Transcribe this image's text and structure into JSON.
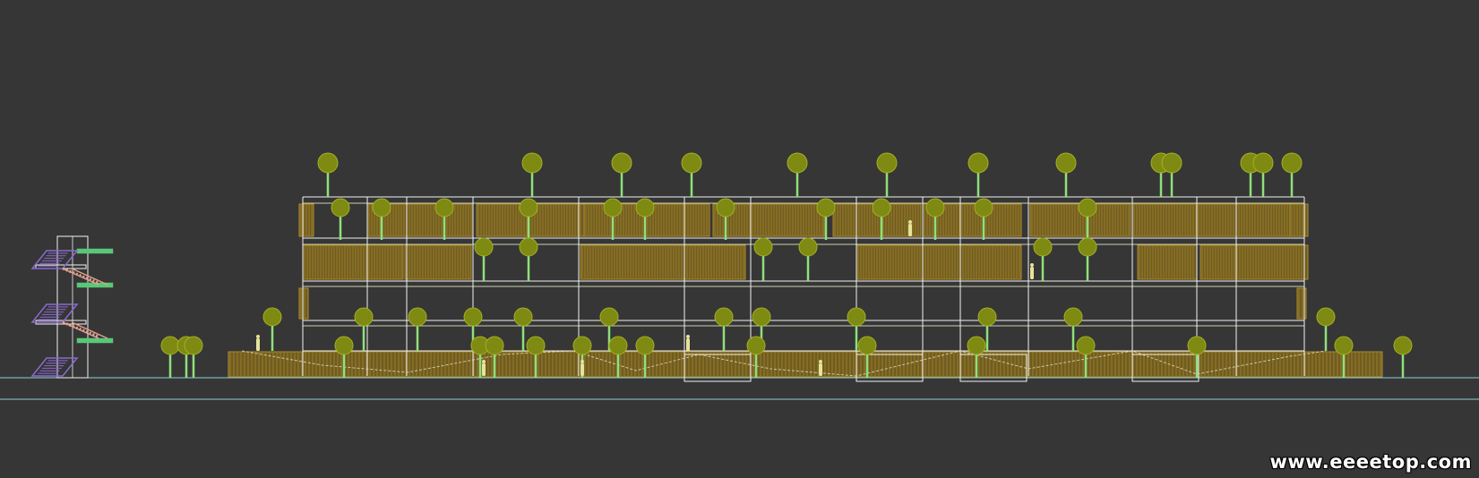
{
  "watermark": "www.eeeetop.com",
  "colors": {
    "background": "#363636",
    "ground_line": "#8fd0d8",
    "frame": "#f2f2f2",
    "floor_band": "#cbd0b0",
    "louver_fill": "#6f5c22",
    "louver_stroke": "#b08e2a",
    "louver_dark": "#4e4219",
    "tree_crown": "#7e8a12",
    "tree_crown_edge": "#a4b022",
    "tree_trunk": "#8fe07a",
    "person": "#e4e49a",
    "stair_purple": "#8a6ad0",
    "stair_pink": "#e2a08e",
    "stair_green": "#58c878"
  },
  "drawing": {
    "title": "",
    "elements": [
      "stair-tower",
      "building-facade",
      "louver-screens",
      "trees",
      "people",
      "ground-line"
    ]
  }
}
